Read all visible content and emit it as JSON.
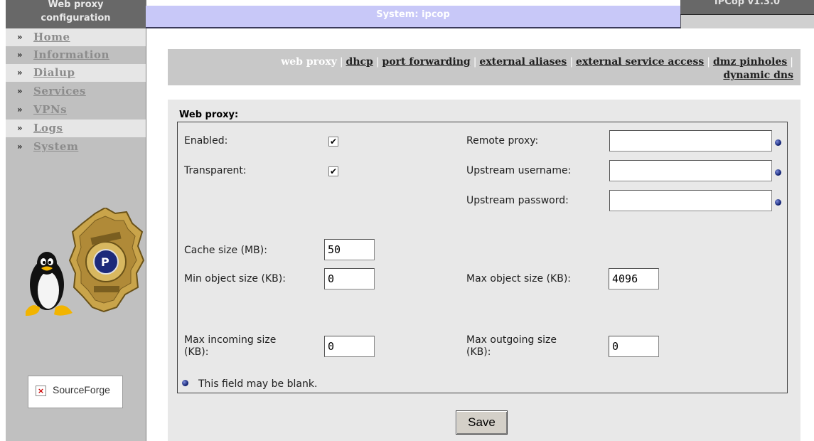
{
  "sidebar": {
    "title_line1": "Web proxy",
    "title_line2": "configuration",
    "arrow": "»",
    "items": [
      {
        "label": "Home"
      },
      {
        "label": "Information"
      },
      {
        "label": "Dialup"
      },
      {
        "label": "Services"
      },
      {
        "label": "VPNs"
      },
      {
        "label": "Logs"
      },
      {
        "label": "System"
      }
    ],
    "sourceforge_text": "SourceForge",
    "broken_image_icon": "broken-image-icon"
  },
  "header": {
    "title": "System: ipcop",
    "version": "IPCop v1.3.0"
  },
  "tabs": {
    "items": [
      {
        "label": "web proxy",
        "active": true
      },
      {
        "label": "dhcp"
      },
      {
        "label": "port forwarding"
      },
      {
        "label": "external aliases"
      },
      {
        "label": "external service access"
      },
      {
        "label": "dmz pinholes"
      },
      {
        "label": "dynamic dns"
      }
    ],
    "separator": "|"
  },
  "form": {
    "section_title": "Web proxy:",
    "enabled_label": "Enabled:",
    "enabled_checked": true,
    "transparent_label": "Transparent:",
    "transparent_checked": true,
    "remote_proxy_label": "Remote proxy:",
    "remote_proxy_value": "",
    "upstream_username_label": "Upstream username:",
    "upstream_username_value": "",
    "upstream_password_label": "Upstream password:",
    "upstream_password_value": "",
    "cache_size_label": "Cache size (MB):",
    "cache_size_value": "50",
    "min_object_label": "Min object size (KB):",
    "min_object_value": "0",
    "max_object_label": "Max object size (KB):",
    "max_object_value": "4096",
    "max_incoming_label_1": "Max incoming size",
    "max_incoming_label_2": "(KB):",
    "max_incoming_value": "0",
    "max_outgoing_label_1": "Max outgoing size",
    "max_outgoing_label_2": "(KB):",
    "max_outgoing_value": "0",
    "blank_note": "This field may be blank.",
    "check_mark": "✔"
  },
  "buttons": {
    "save_label": "Save"
  },
  "colors": {
    "header_bg": "#c8c8f8",
    "sidebar_bg": "#c0c0c0",
    "panel_bg": "#e8e8e8",
    "blank_dot": "#0a1a6a"
  }
}
